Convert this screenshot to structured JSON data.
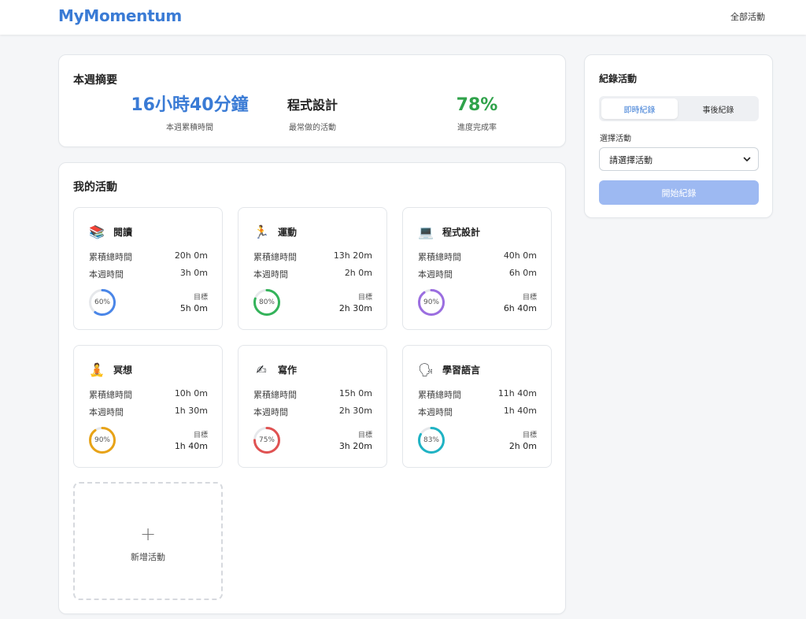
{
  "navbar": {
    "brand": "MyMomentum",
    "link": "全部活動"
  },
  "summary": {
    "title": "本週摘要",
    "stats": [
      {
        "value": "16小時40分鐘",
        "label": "本週累積時間",
        "color": "#3a7bd5"
      },
      {
        "value": "程式設計",
        "label": "最常做的活動",
        "color": "#222222"
      },
      {
        "value": "78%",
        "label": "進度完成率",
        "color": "#2fa24a"
      }
    ]
  },
  "activities": {
    "title": "我的活動",
    "total_label": "累積總時間",
    "week_label": "本週時間",
    "goal_label": "目標",
    "items": [
      {
        "name": "閱讀",
        "icon": "books-icon",
        "glyph": "📚",
        "total": "20h 0m",
        "week": "3h 0m",
        "progress_text": "60%",
        "progress": 0.6,
        "goal": "5h 0m",
        "color": "#4a86e8"
      },
      {
        "name": "運動",
        "icon": "runner-icon",
        "glyph": "🏃",
        "total": "13h 20m",
        "week": "2h 0m",
        "progress_text": "80%",
        "progress": 0.8,
        "goal": "2h 30m",
        "color": "#34b35a"
      },
      {
        "name": "程式設計",
        "icon": "laptop-icon",
        "glyph": "💻",
        "total": "40h 0m",
        "week": "6h 0m",
        "progress_text": "90%",
        "progress": 0.9,
        "goal": "6h 40m",
        "color": "#9b6ee0"
      },
      {
        "name": "冥想",
        "icon": "meditation-icon",
        "glyph": "🧘",
        "total": "10h 0m",
        "week": "1h 30m",
        "progress_text": "90%",
        "progress": 0.9,
        "goal": "1h 40m",
        "color": "#e8a317"
      },
      {
        "name": "寫作",
        "icon": "writing-icon",
        "glyph": "✍",
        "total": "15h 0m",
        "week": "2h 30m",
        "progress_text": "75%",
        "progress": 0.75,
        "goal": "3h 20m",
        "color": "#e05252"
      },
      {
        "name": "學習語言",
        "icon": "speaking-head-icon",
        "glyph": "🗣",
        "total": "11h 40m",
        "week": "1h 40m",
        "progress_text": "83%",
        "progress": 0.83,
        "goal": "2h 0m",
        "color": "#1fb3c4"
      }
    ],
    "add_label": "新增活動",
    "add_plus": "+"
  },
  "record": {
    "title": "紀錄活動",
    "tabs": [
      "即時紀錄",
      "事後紀錄"
    ],
    "select_label": "選擇活動",
    "select_value": "請選擇活動",
    "start_label": "開始紀錄"
  }
}
